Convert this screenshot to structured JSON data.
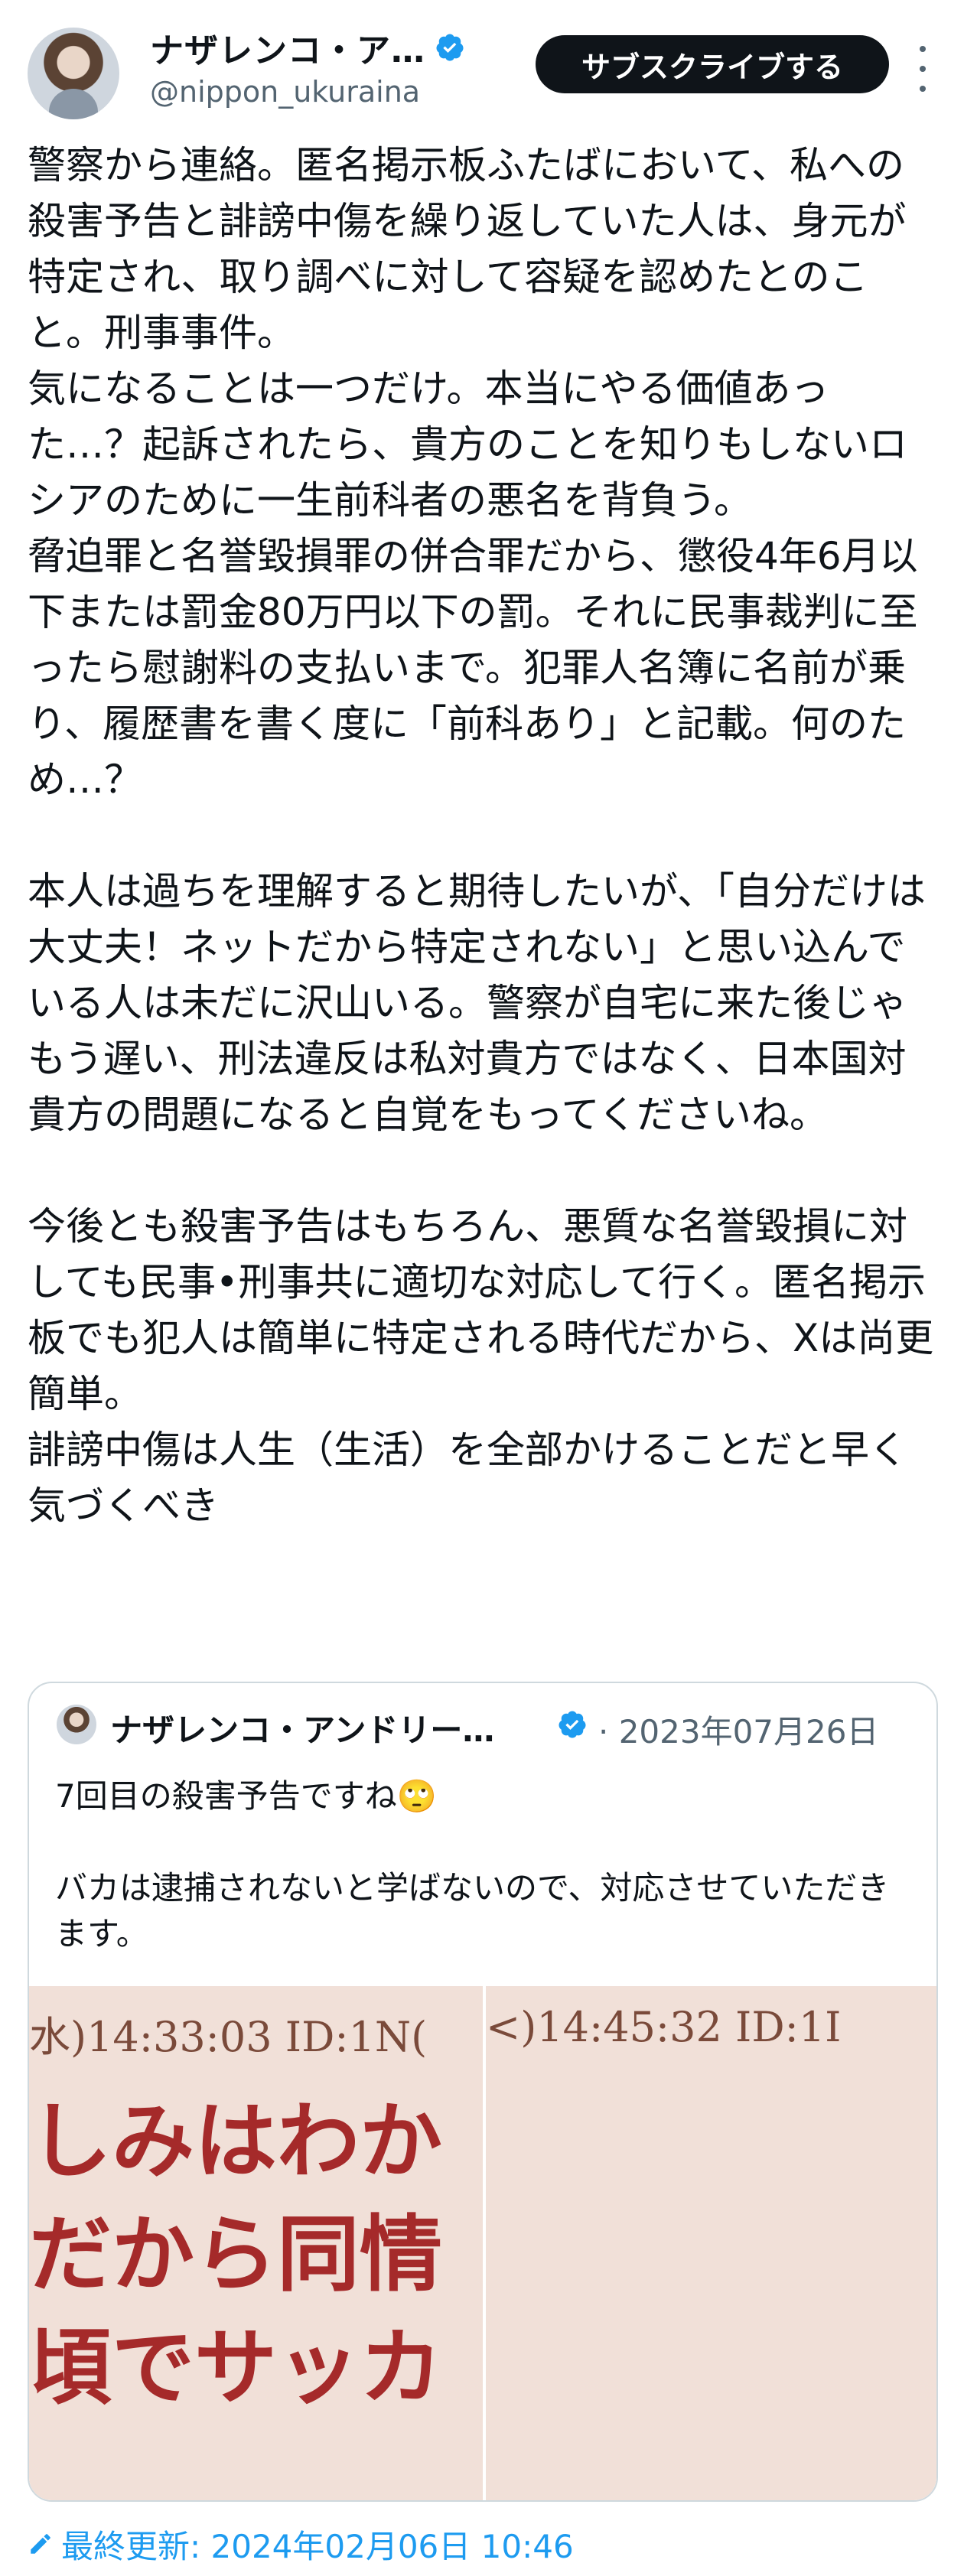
{
  "author": {
    "name": "ナザレンコ・ア…",
    "handle": "@nippon_ukuraina",
    "verified": true
  },
  "subscribe_label": "サブスクライブする",
  "tweet_text": "警察から連絡。匿名掲示板ふたばにおいて、私への殺害予告と誹謗中傷を繰り返していた人は、身元が特定され、取り調べに対して容疑を認めたとのこと。刑事事件。\n気になることは一つだけ。本当にやる価値あった…？起訴されたら、貴方のことを知りもしないロシアのために一生前科者の悪名を背負う。\n脅迫罪と名誉毀損罪の併合罪だから、懲役4年6月以下または罰金80万円以下の罰。それに民事裁判に至ったら慰謝料の支払いまで。犯罪人名簿に名前が乗り、履歴書を書く度に「前科あり」と記載。何のため…？\n\n本人は過ちを理解すると期待したいが、「自分だけは大丈夫！ネットだから特定されない」と思い込んでいる人は未だに沢山いる。警察が自宅に来た後じゃもう遅い、刑法違反は私対貴方ではなく、日本国対貴方の問題になると自覚をもってくださいね。\n\n今後とも殺害予告はもちろん、悪質な名誉毀損に対しても民事•刑事共に適切な対応して行く。匿名掲示板でも犯人は簡単に特定される時代だから、Xは尚更簡単。\n誹謗中傷は人生（生活）を全部かけることだと早く気づくべき",
  "quote": {
    "name": "ナザレンコ・アンドリー…",
    "date": "· 2023年07月26日",
    "text": "7回目の殺害予告ですね🙄\n\nバカは逮捕されないと学ばないので、対応させていただきます。",
    "images": [
      {
        "timestamp": "水)14:33:03 ID:1N(",
        "lines": "しみはわか\nだから同情\n頃でサッカ"
      },
      {
        "timestamp": "<)14:45:32 ID:1I",
        "lines": ""
      }
    ]
  },
  "footer": {
    "last_updated": "最終更新: 2024年02月06日 10:46"
  },
  "colors": {
    "accent": "#1d9bf0",
    "text": "#0f1419",
    "muted": "#536471",
    "border": "#cfd9de",
    "image_bg": "#f1e0d8",
    "image_red": "#a52a2a"
  }
}
